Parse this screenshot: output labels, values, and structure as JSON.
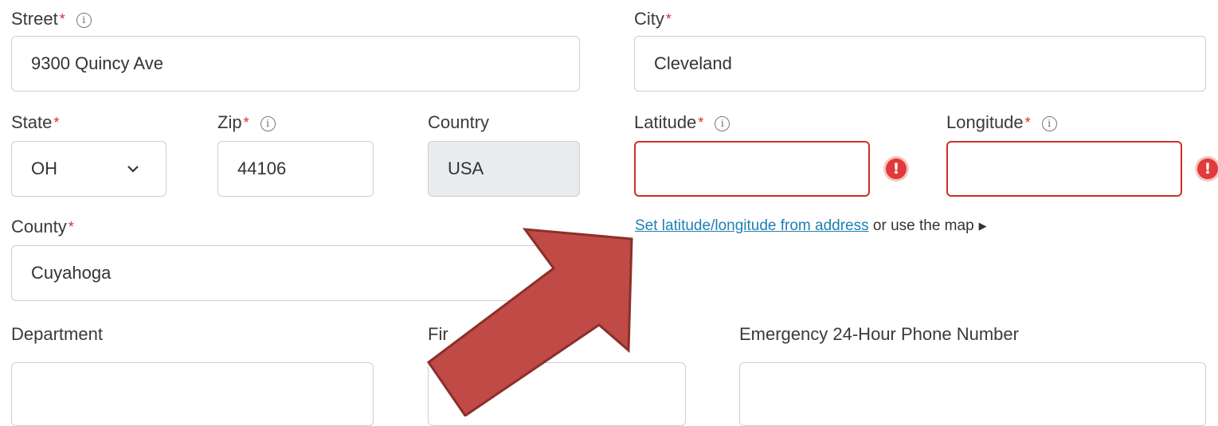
{
  "street": {
    "label": "Street",
    "required": "*",
    "value": "9300 Quincy Ave"
  },
  "city": {
    "label": "City",
    "required": "*",
    "value": "Cleveland"
  },
  "state": {
    "label": "State",
    "required": "*",
    "value": "OH"
  },
  "zip": {
    "label": "Zip",
    "required": "*",
    "value": "44106"
  },
  "country": {
    "label": "Country",
    "value": "USA"
  },
  "latitude": {
    "label": "Latitude",
    "required": "*",
    "value": ""
  },
  "longitude": {
    "label": "Longitude",
    "required": "*",
    "value": ""
  },
  "geo": {
    "link_text": "Set latitude/longitude from address",
    "suffix": "or use the map",
    "toggle_glyph": "▶"
  },
  "county": {
    "label": "County",
    "required": "*",
    "value": "Cuyahoga"
  },
  "department": {
    "label": "Department",
    "value": ""
  },
  "fire": {
    "label": "Fir",
    "value": ""
  },
  "emergency_phone": {
    "label": "Emergency 24-Hour Phone Number",
    "value": ""
  },
  "icons": {
    "info": "i",
    "error": "!"
  },
  "colors": {
    "required": "#d0312d",
    "error_border": "#c9302c",
    "link": "#1f7fb3",
    "arrow_fill": "#bf4a46",
    "arrow_stroke": "#8c2f2c"
  }
}
